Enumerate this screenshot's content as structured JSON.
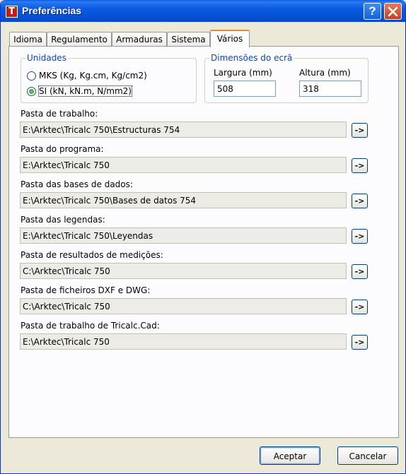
{
  "window": {
    "title": "Preferências",
    "app_icon_letter": "T",
    "help_label": "?"
  },
  "tabs": [
    {
      "label": "Idioma"
    },
    {
      "label": "Regulamento"
    },
    {
      "label": "Armaduras"
    },
    {
      "label": "Sistema"
    },
    {
      "label": "Vários"
    }
  ],
  "active_tab": "Vários",
  "units": {
    "legend": "Unidades",
    "options": [
      {
        "label": "MKS (Kg, Kg.cm, Kg/cm2)",
        "selected": false
      },
      {
        "label": "SI (kN, kN.m, N/mm2)",
        "selected": true
      }
    ]
  },
  "screen": {
    "legend": "Dimensões do ecrã",
    "width_label": "Largura (mm)",
    "width_value": "508",
    "height_label": "Altura (mm)",
    "height_value": "318"
  },
  "folders": [
    {
      "label": "Pasta de trabalho:",
      "value": "E:\\Arktec\\Tricalc 750\\Estructuras 754",
      "button": "->"
    },
    {
      "label": "Pasta do programa:",
      "value": "E:\\Arktec\\Tricalc 750",
      "button": "->"
    },
    {
      "label": "Pasta das bases de dados:",
      "value": "E:\\Arktec\\Tricalc 750\\Bases de datos 754",
      "button": "->"
    },
    {
      "label": "Pasta das legendas:",
      "value": "E:\\Arktec\\Tricalc 750\\Leyendas",
      "button": "->"
    },
    {
      "label": "Pasta de resultados de medições:",
      "value": "C:\\Arktec\\Tricalc 750",
      "button": "->"
    },
    {
      "label": "Pasta de ficheiros DXF e DWG:",
      "value": "C:\\Arktec\\Tricalc 750",
      "button": "->"
    },
    {
      "label": "Pasta de trabalho de Tricalc.Cad:",
      "value": "E:\\Arktec\\Tricalc 750",
      "button": "->"
    }
  ],
  "buttons": {
    "ok": "Aceptar",
    "cancel": "Cancelar"
  },
  "colors": {
    "titlebar": "#0553d6",
    "legend_text": "#0046d5",
    "active_tab_accent": "#e68b2c"
  }
}
